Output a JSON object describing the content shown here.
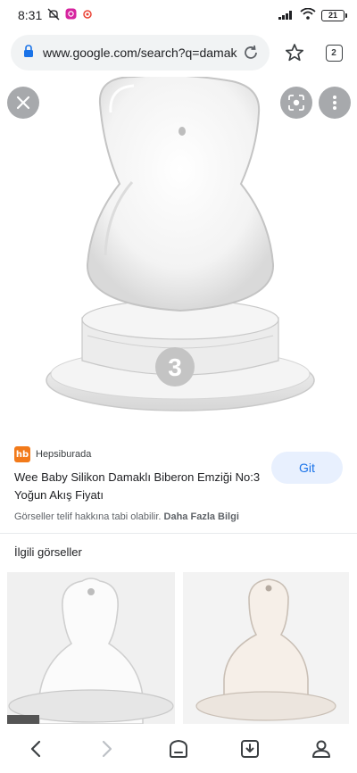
{
  "status_bar": {
    "time": "8:31",
    "battery": "21"
  },
  "browser": {
    "url": "www.google.com/search?q=damak",
    "tab_count": "2"
  },
  "product_image": {
    "nipple_number": "3"
  },
  "result": {
    "source": "Hepsiburada",
    "source_logo_text": "hb",
    "title": "Wee Baby Silikon Damaklı Biberon Emziği No:3 Yoğun Akış Fiyatı",
    "visit_label": "Git",
    "copyright_text": "Görseller telif hakkına tabi olabilir.",
    "learn_more": "Daha Fazla Bilgi"
  },
  "related": {
    "title": "İlgili görseller"
  },
  "colors": {
    "accent": "#1a73e8",
    "brand_hb": "#f27a1a"
  }
}
